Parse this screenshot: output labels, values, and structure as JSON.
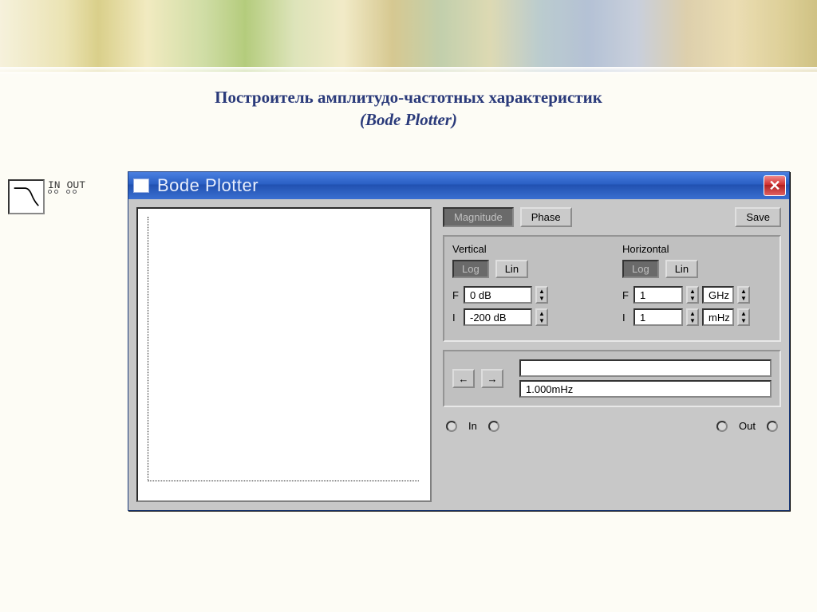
{
  "slide": {
    "title_line1": "Построитель амплитудо-частотных характеристик",
    "title_line2": "(Bode Plotter)"
  },
  "instrument_icon": {
    "in_label": "IN",
    "out_label": "OUT"
  },
  "window": {
    "title": "Bode Plotter",
    "buttons": {
      "magnitude": "Magnitude",
      "phase": "Phase",
      "save": "Save"
    },
    "vertical": {
      "title": "Vertical",
      "log": "Log",
      "lin": "Lin",
      "f_label": "F",
      "i_label": "I",
      "f_value": "0 dB",
      "i_value": "-200 dB"
    },
    "horizontal": {
      "title": "Horizontal",
      "log": "Log",
      "lin": "Lin",
      "f_label": "F",
      "i_label": "I",
      "f_value": "1",
      "i_value": "1",
      "f_unit": "GHz",
      "i_unit": "mHz"
    },
    "cursor": {
      "value_top": "",
      "value_bottom": "1.000mHz"
    },
    "io": {
      "in": "In",
      "out": "Out"
    }
  }
}
